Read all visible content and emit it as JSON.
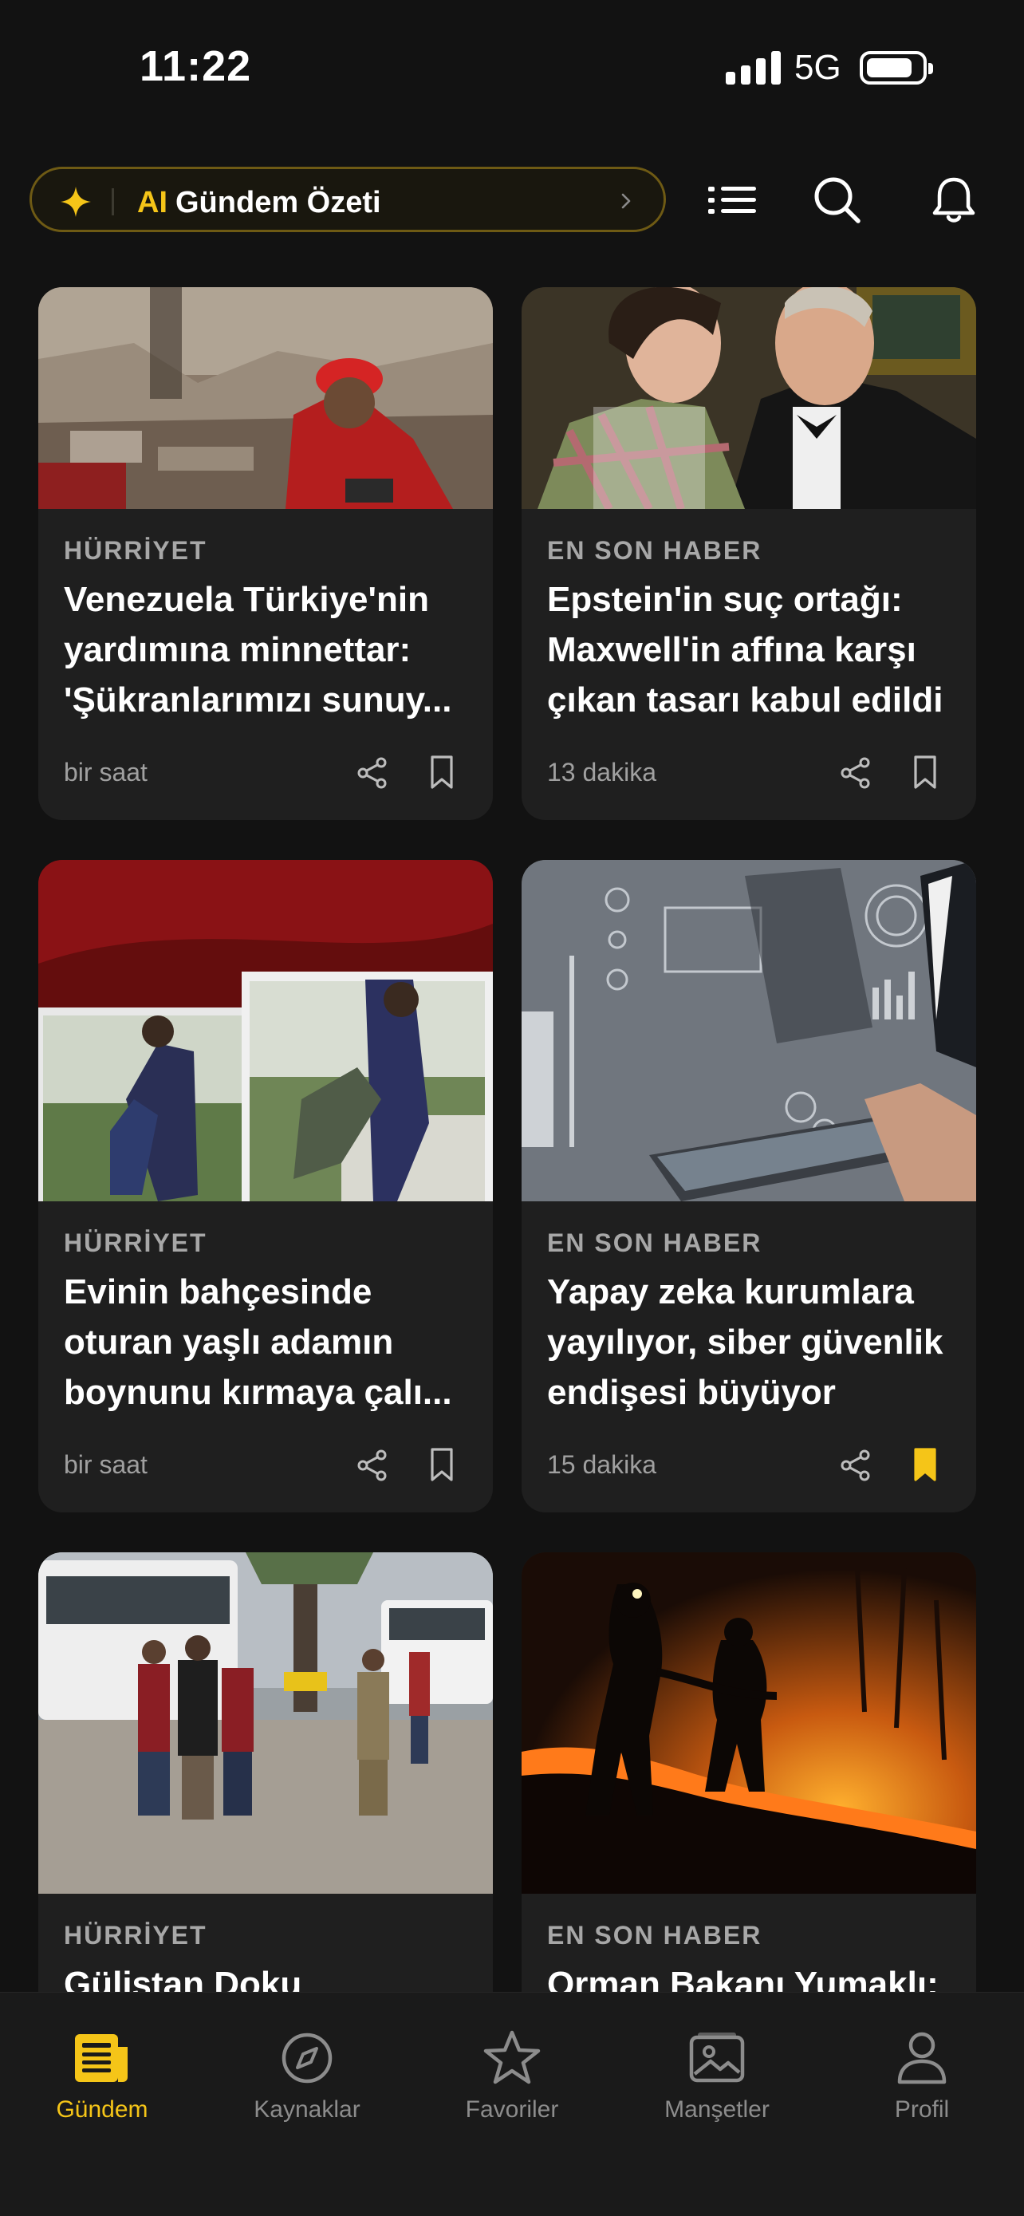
{
  "status": {
    "time": "11:22",
    "network": "5G"
  },
  "header": {
    "ai_label": "AI",
    "summary_label": "Gündem Özeti",
    "icons": [
      "sparkle-icon",
      "list-icon",
      "search-icon",
      "bell-icon"
    ]
  },
  "colors": {
    "accent": "#f5c518",
    "background": "#121212",
    "card": "#1f1f1f"
  },
  "cards": [
    {
      "source": "HÜRRİYET",
      "title_lines": [
        "Venezuela Türkiye'nin",
        "yardımına minnettar:",
        "'Şükranlarımızı sunuy..."
      ],
      "time": "bir saat",
      "bookmarked": false
    },
    {
      "source": "EN SON HABER",
      "title_lines": [
        "Epstein'in suç ortağı:",
        "Maxwell'in affına karşı",
        "çıkan tasarı kabul edildi"
      ],
      "time": "13 dakika",
      "bookmarked": false
    },
    {
      "source": "HÜRRİYET",
      "title_lines": [
        "Evinin bahçesinde",
        "oturan yaşlı adamın",
        "boynunu kırmaya çalı..."
      ],
      "time": "bir saat",
      "bookmarked": false
    },
    {
      "source": "EN SON HABER",
      "title_lines": [
        "Yapay zeka kurumlara",
        "yayılıyor, siber güvenlik",
        "endişesi büyüyor"
      ],
      "time": "15 dakika",
      "bookmarked": true
    },
    {
      "source": "HÜRRİYET",
      "title_lines": [
        "Gülistan Doku"
      ],
      "time": "",
      "bookmarked": false
    },
    {
      "source": "EN SON HABER",
      "title_lines": [
        "Orman Bakanı Yumaklı:"
      ],
      "time": "",
      "bookmarked": false
    }
  ],
  "tabs": [
    {
      "label": "Gündem",
      "icon": "newspaper-icon",
      "active": true
    },
    {
      "label": "Kaynaklar",
      "icon": "compass-icon",
      "active": false
    },
    {
      "label": "Favoriler",
      "icon": "star-icon",
      "active": false
    },
    {
      "label": "Manşetler",
      "icon": "gallery-icon",
      "active": false
    },
    {
      "label": "Profil",
      "icon": "person-icon",
      "active": false
    }
  ]
}
